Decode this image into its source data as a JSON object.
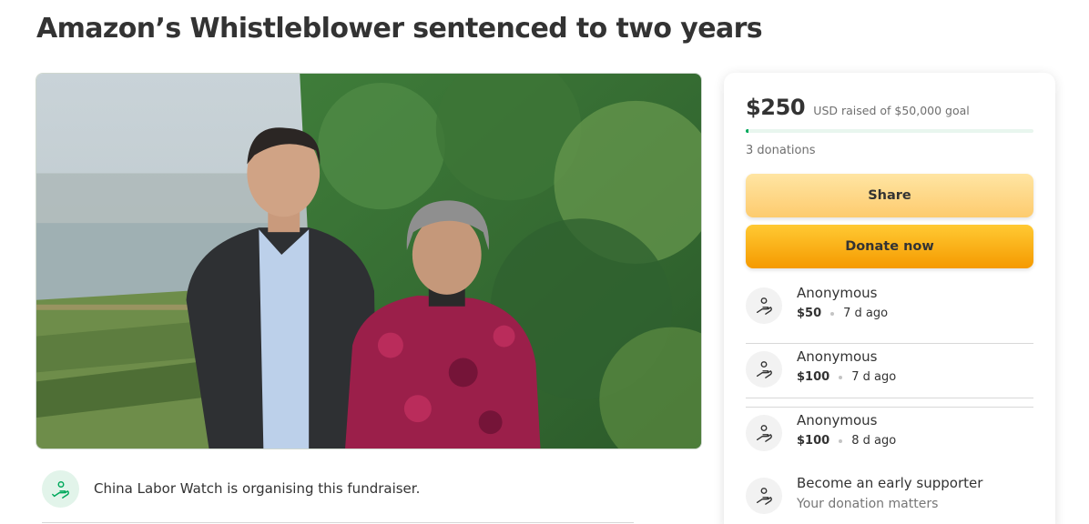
{
  "page": {
    "title": "Amazon’s Whistleblower sentenced to two years"
  },
  "hero_image": {
    "icon": "campaign-photo"
  },
  "organiser": {
    "text": "China Labor Watch is organising this fundraiser.",
    "icon": "hand-heart-icon"
  },
  "progress": {
    "amount": "$250",
    "goal_text": "USD raised of $50,000 goal",
    "fraction_raised": 0.005,
    "donations_count_text": "3 donations"
  },
  "buttons": {
    "share_label": "Share",
    "donate_label": "Donate now"
  },
  "donations": [
    {
      "name": "Anonymous",
      "amount": "$50",
      "time": "7 d ago"
    },
    {
      "name": "Anonymous",
      "amount": "$100",
      "time": "7 d ago"
    },
    {
      "name": "Anonymous",
      "amount": "$100",
      "time": "8 d ago"
    }
  ],
  "early_supporter": {
    "title": "Become an early supporter",
    "subtitle": "Your donation matters"
  },
  "colors": {
    "brand_green": "#02a95c",
    "donate_orange": "#f59a00",
    "share_yellow": "#fdcb6e"
  }
}
